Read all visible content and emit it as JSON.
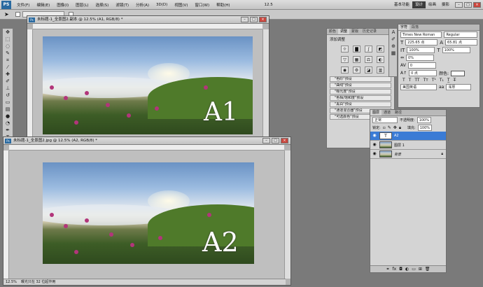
{
  "menubar": {
    "logo": "PS",
    "items": [
      "文件(F)",
      "编辑(E)",
      "图像(I)",
      "图层(L)",
      "选择(S)",
      "滤镜(T)",
      "分析(A)",
      "3D(D)",
      "视图(V)",
      "窗口(W)",
      "帮助(H)"
    ],
    "zoom": "12.5",
    "workspaces": [
      "基本功能",
      "设计",
      "绘画",
      "摄影"
    ],
    "active_workspace": "设计"
  },
  "doc1": {
    "title": "未标题-1_全景图2.副本 @ 12.5% (A1, RGB/8) *",
    "label": "A1"
  },
  "doc2": {
    "title": "未标题-1_全景图2.jpg @ 12.5% (A2, RGB/8) *",
    "label": "A2",
    "zoom": "12.5%",
    "status": "曝光只在 32 位起作用"
  },
  "adjust_panel": {
    "tabs": [
      "颜色",
      "调整",
      "蒙版",
      "历史记录"
    ],
    "active_tab": "调整",
    "title": "添加调整",
    "presets": [
      "\"色阶\"预设",
      "\"曲线\"预设",
      "\"曝光度\"预设",
      "\"色相/饱和度\"预设",
      "\"黑白\"预设",
      "\"通道混合器\"预设",
      "\"可选颜色\"预设"
    ]
  },
  "character_panel": {
    "tabs": [
      "字符",
      "段落"
    ],
    "font": "Times New Roman",
    "style": "Regular",
    "size": "225.65 点",
    "leading": "65.81 点",
    "scale_v": "100%",
    "scale_h": "100%",
    "tracking": "0%",
    "kerning": "0",
    "baseline": "0 点",
    "color_label": "颜色:",
    "language": "美国英语",
    "antialias": "浑厚"
  },
  "layers_panel": {
    "tabs": [
      "图层",
      "通道",
      "路径"
    ],
    "blend_mode": "正常",
    "opacity_label": "不透明度:",
    "opacity": "100%",
    "lock_label": "锁定:",
    "fill_label": "填充:",
    "fill": "100%",
    "layers": [
      {
        "name": "A2",
        "type": "text",
        "selected": true
      },
      {
        "name": "图层 1",
        "type": "image",
        "selected": false
      },
      {
        "name": "背景",
        "type": "image",
        "selected": false
      }
    ]
  },
  "colors": {
    "selection": "#3a7bd5",
    "close": "#c9463d"
  }
}
